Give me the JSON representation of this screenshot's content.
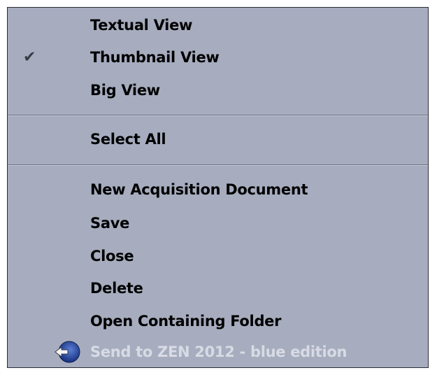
{
  "menu": {
    "items": [
      {
        "label": "Textual View"
      },
      {
        "label": "Thumbnail View",
        "checked": true,
        "check_glyph": "✔"
      },
      {
        "label": "Big View"
      },
      {
        "label": "Select All"
      },
      {
        "label": "New Acquisition Document"
      },
      {
        "label": "Save"
      },
      {
        "label": "Close"
      },
      {
        "label": "Delete"
      },
      {
        "label": "Open Containing Folder"
      },
      {
        "label": "Send to ZEN 2012 - blue edition",
        "disabled": true,
        "icon": "zen-blue-edition-icon"
      }
    ]
  },
  "colors": {
    "menu_background": "#a7adbf",
    "menu_border": "#2a2d36",
    "text": "#000000",
    "disabled_text": "#d8dbe4",
    "icon_blue": "#1f3f9a"
  }
}
